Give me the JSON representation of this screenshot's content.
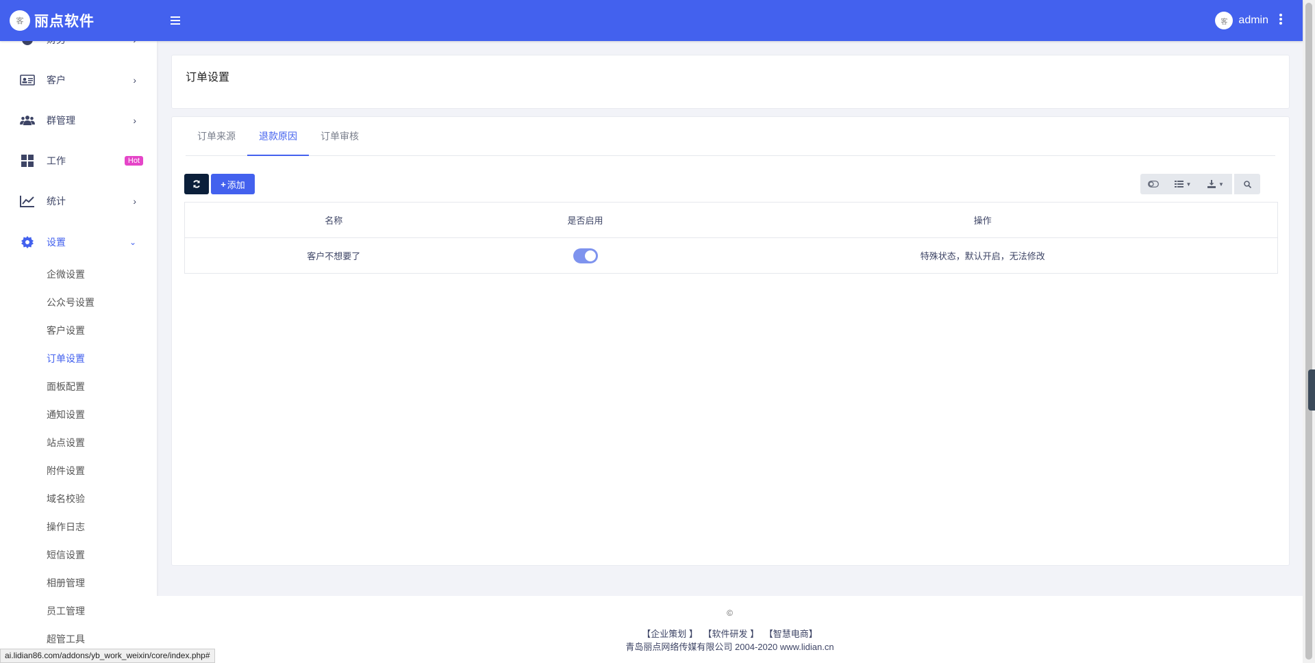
{
  "header": {
    "brand_logo_text": "客",
    "brand_name": "丽点软件",
    "menu_icon": "hamburger-icon",
    "user_name": "admin",
    "more_icon": "kebab-icon"
  },
  "sidebar": {
    "partial_item_label": "财务",
    "items": [
      {
        "label": "客户",
        "icon": "id-card-icon"
      },
      {
        "label": "群管理",
        "icon": "users-icon"
      },
      {
        "label": "工作",
        "icon": "grid-icon",
        "badge": "Hot"
      },
      {
        "label": "统计",
        "icon": "chart-line-icon"
      },
      {
        "label": "设置",
        "icon": "gear-icon"
      }
    ],
    "sub_items": [
      "企微设置",
      "公众号设置",
      "客户设置",
      "订单设置",
      "面板配置",
      "通知设置",
      "站点设置",
      "附件设置",
      "域名校验",
      "操作日志",
      "短信设置",
      "相册管理",
      "员工管理",
      "超管工具"
    ],
    "active_sub": "订单设置"
  },
  "page": {
    "title": "订单设置"
  },
  "tabs": [
    {
      "label": "订单来源"
    },
    {
      "label": "退款原因"
    },
    {
      "label": "订单审核"
    }
  ],
  "toolbar": {
    "refresh_icon": "refresh-icon",
    "add_label": "添加",
    "tools": [
      "toggle-view-icon",
      "columns-icon",
      "export-icon",
      "search-icon"
    ]
  },
  "table": {
    "headers": [
      "名称",
      "是否启用",
      "操作"
    ],
    "rows": [
      {
        "name": "客户不想要了",
        "enabled": true,
        "action": "特殊状态，默认开启，无法修改"
      }
    ]
  },
  "footer": {
    "copyright": "©",
    "links": [
      "【企业策划 】",
      "【软件研发 】",
      "【智慧电商】"
    ],
    "company": "青岛丽点网络传媒有限公司 2004-2020 www.lidian.cn"
  },
  "status_bar": "ai.lidian86.com/addons/yb_work_weixin/core/index.php#",
  "colors": {
    "primary": "#4361ee",
    "hot_badge": "#e545c8",
    "dark_button": "#0b1f3a"
  }
}
